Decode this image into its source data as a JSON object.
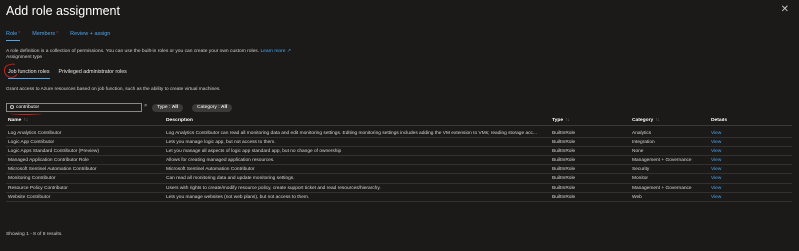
{
  "header": {
    "title": "Add role assignment",
    "more": "···",
    "close": "✕"
  },
  "tabs": [
    {
      "label": "Role",
      "required": true
    },
    {
      "label": "Members",
      "required": true
    },
    {
      "label": "Review + assign",
      "required": false
    }
  ],
  "required_mark": "*",
  "intro": {
    "text": "A role definition is a collection of permissions. You can use the built-in roles or you can create your own custom roles. ",
    "link": "Learn more ↗",
    "assignment_type": "Assignment type"
  },
  "subtabs": [
    {
      "label": "Job function roles"
    },
    {
      "label": "Privileged administrator roles"
    }
  ],
  "grant_text": "Grant access to Azure resources based on job function, such as the ability to create virtual machines.",
  "search": {
    "value": "contributor",
    "clear": "×"
  },
  "filters": [
    {
      "key": "Type : ",
      "value": "All"
    },
    {
      "key": "Category : ",
      "value": "All"
    }
  ],
  "table": {
    "columns": [
      "Name",
      "Description",
      "Type",
      "Category",
      "Details"
    ],
    "sort_glyph": "↑↓",
    "rows": [
      {
        "name": "Log Analytics Contributor",
        "description": "Log Analytics Contributor can read all monitoring data and edit monitoring settings. Editing monitoring settings includes adding the VM extension to VMs; reading storage acc...",
        "type": "BuiltInRole",
        "category": "Analytics",
        "details": "View"
      },
      {
        "name": "Logic App Contributor",
        "description": "Lets you manage logic app, but not access to them.",
        "type": "BuiltInRole",
        "category": "Integration",
        "details": "View"
      },
      {
        "name": "Logic Apps Standard Contributor (Preview)",
        "description": "Let you manage all aspects of logic app standard app, but no change of ownership",
        "type": "BuiltInRole",
        "category": "None",
        "details": "View"
      },
      {
        "name": "Managed Application Contributor Role",
        "description": "Allows for creating managed application resources.",
        "type": "BuiltInRole",
        "category": "Management + Governance",
        "details": "View"
      },
      {
        "name": "Microsoft Sentinel Automation Contributor",
        "description": "Microsoft Sentinel Automation Contributor",
        "type": "BuiltInRole",
        "category": "Security",
        "details": "View"
      },
      {
        "name": "Monitoring Contributor",
        "description": "Can read all monitoring data and update monitoring settings.",
        "type": "BuiltInRole",
        "category": "Monitor",
        "details": "View"
      },
      {
        "name": "Resource Policy Contributor",
        "description": "Users with rights to create/modify resource policy, create support ticket and read resources/hierarchy.",
        "type": "BuiltInRole",
        "category": "Management + Governance",
        "details": "View"
      },
      {
        "name": "Website Contributor",
        "description": "Lets you manage websites (not web plans), but not access to them.",
        "type": "BuiltInRole",
        "category": "Web",
        "details": "View"
      }
    ]
  },
  "footer": {
    "showing": "Showing 1 - 8 of 8 results."
  }
}
